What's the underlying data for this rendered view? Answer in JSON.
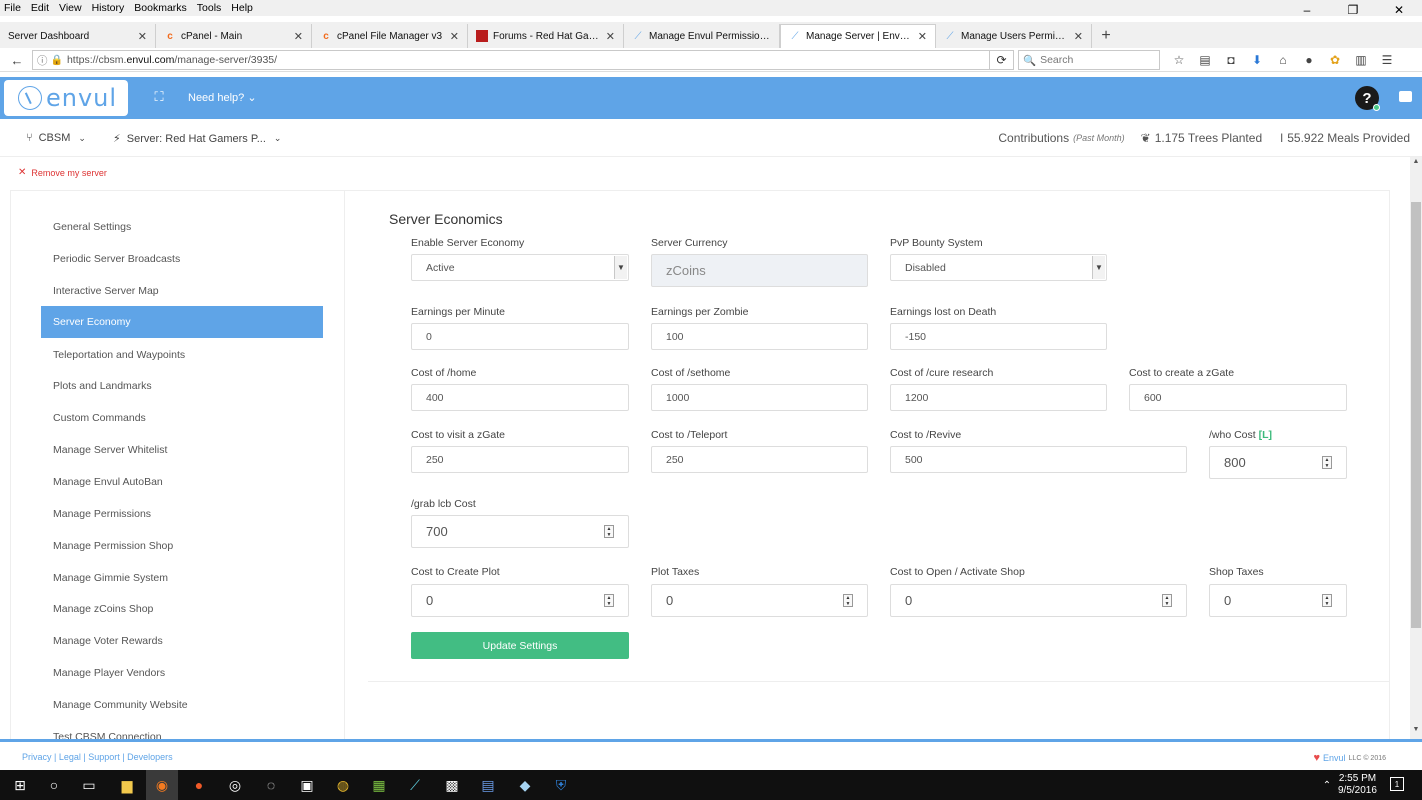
{
  "browser": {
    "menu": [
      "File",
      "Edit",
      "View",
      "History",
      "Bookmarks",
      "Tools",
      "Help"
    ],
    "window_controls": [
      "–",
      "❐",
      "✕"
    ],
    "tabs": [
      {
        "label": "Server Dashboard",
        "icon": "none",
        "active": false
      },
      {
        "label": "cPanel - Main",
        "icon": "cpanel-icon",
        "active": false
      },
      {
        "label": "cPanel File Manager v3",
        "icon": "cpanel-icon",
        "active": false
      },
      {
        "label": "Forums - Red Hat Gamers",
        "icon": "redhat-icon",
        "active": false
      },
      {
        "label": "Manage Envul Permission...",
        "icon": "envul-icon",
        "active": false
      },
      {
        "label": "Manage Server | Envul - Cl...",
        "icon": "envul-icon",
        "active": true
      },
      {
        "label": "Manage Users Permission...",
        "icon": "envul-icon",
        "active": false
      }
    ],
    "url_prefix": "https://cbsm.",
    "url_host": "envul.com",
    "url_path": "/manage-server/3935/",
    "search_placeholder": "Search"
  },
  "header": {
    "logo_text": "envul",
    "need_help": "Need help?",
    "help_symbol": "?",
    "accent_color": "#5fa4e7"
  },
  "subheader": {
    "crumb_cbsm": "CBSM",
    "crumb_server": "Server: Red Hat Gamers P...",
    "contributions": "Contributions",
    "past_month": "(Past Month)",
    "trees": "1.175 Trees Planted",
    "meals": "55.922 Meals Provided"
  },
  "remove_server": "Remove my server",
  "sidebar": {
    "items": [
      {
        "label": "General Settings",
        "active": false
      },
      {
        "label": "Periodic Server Broadcasts",
        "active": false
      },
      {
        "label": "Interactive Server Map",
        "active": false
      },
      {
        "label": "Server Economy",
        "active": true
      },
      {
        "label": "Teleportation and Waypoints",
        "active": false
      },
      {
        "label": "Plots and Landmarks",
        "active": false
      },
      {
        "label": "Custom Commands",
        "active": false
      },
      {
        "label": "Manage Server Whitelist",
        "active": false
      },
      {
        "label": "Manage Envul AutoBan",
        "active": false
      },
      {
        "label": "Manage Permissions",
        "active": false
      },
      {
        "label": "Manage Permission Shop",
        "active": false
      },
      {
        "label": "Manage Gimmie System",
        "active": false
      },
      {
        "label": "Manage zCoins Shop",
        "active": false
      },
      {
        "label": "Manage Voter Rewards",
        "active": false
      },
      {
        "label": "Manage Player Vendors",
        "active": false
      },
      {
        "label": "Manage Community Website",
        "active": false
      },
      {
        "label": "Test CBSM Connection",
        "active": false
      }
    ]
  },
  "economy": {
    "section_title": "Server Economics",
    "enable_economy": {
      "label": "Enable Server Economy",
      "value": "Active"
    },
    "currency": {
      "label": "Server Currency",
      "value": "zCoins"
    },
    "pvp_bounty": {
      "label": "PvP Bounty System",
      "value": "Disabled"
    },
    "earn_minute": {
      "label": "Earnings per Minute",
      "value": "0"
    },
    "earn_zombie": {
      "label": "Earnings per Zombie",
      "value": "100"
    },
    "lost_death": {
      "label": "Earnings lost on Death",
      "value": "-150"
    },
    "cost_home": {
      "label": "Cost of /home",
      "value": "400"
    },
    "cost_sethome": {
      "label": "Cost of /sethome",
      "value": "1000"
    },
    "cost_cure": {
      "label": "Cost of /cure research",
      "value": "1200"
    },
    "cost_create_zgate": {
      "label": "Cost to create a zGate",
      "value": "600"
    },
    "cost_visit_zgate": {
      "label": "Cost to visit a zGate",
      "value": "250"
    },
    "cost_teleport": {
      "label": "Cost to /Teleport",
      "value": "250"
    },
    "cost_revive": {
      "label": "Cost to /Revive",
      "value": "500"
    },
    "who_cost": {
      "label": "/who Cost",
      "badge": "[L]",
      "value": "800"
    },
    "grab_lcb": {
      "label": "/grab lcb Cost",
      "value": "700"
    },
    "create_plot": {
      "label": "Cost to Create Plot",
      "value": "0"
    },
    "plot_taxes": {
      "label": "Plot Taxes",
      "value": "0"
    },
    "open_shop": {
      "label": "Cost to Open / Activate Shop",
      "value": "0"
    },
    "shop_taxes": {
      "label": "Shop Taxes",
      "value": "0"
    },
    "update_button": "Update Settings"
  },
  "footer": {
    "links": "Privacy | Legal | Support | Developers",
    "brand": "Envul",
    "llc": "LLC © 2016"
  },
  "taskbar": {
    "time": "2:55 PM",
    "date": "9/5/2016",
    "notifications": "1"
  }
}
